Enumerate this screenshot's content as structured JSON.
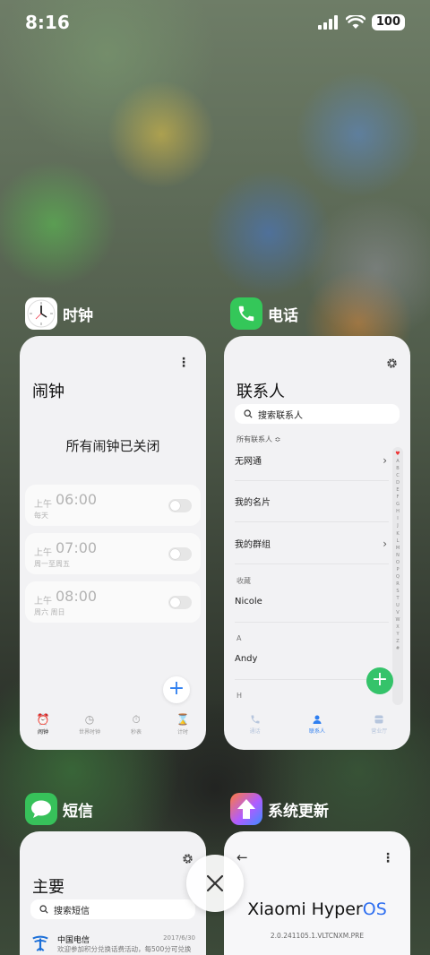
{
  "status_bar": {
    "time": "8:16",
    "battery": "100"
  },
  "apps": {
    "clock": {
      "label": "时钟",
      "screen_title": "闹钟",
      "status_text": "所有闹钟已关闭",
      "alarms": [
        {
          "ampm": "上午",
          "time": "06:00",
          "days": "每天",
          "enabled": false
        },
        {
          "ampm": "上午",
          "time": "07:00",
          "days": "周一至周五",
          "enabled": false
        },
        {
          "ampm": "上午",
          "time": "08:00",
          "days": "周六 周日",
          "enabled": false
        }
      ],
      "nav": [
        {
          "label": "闹钟",
          "icon": "alarm-clock-icon",
          "active": true
        },
        {
          "label": "世界时钟",
          "icon": "world-clock-icon",
          "active": false
        },
        {
          "label": "秒表",
          "icon": "stopwatch-icon",
          "active": false
        },
        {
          "label": "计时",
          "icon": "hourglass-icon",
          "active": false
        }
      ]
    },
    "phone": {
      "label": "电话",
      "screen_title": "联系人",
      "search_placeholder": "搜索联系人",
      "filter": "所有联系人 ≎",
      "rows": [
        {
          "label": "无网通",
          "chevron": true
        },
        {
          "label": "我的名片",
          "chevron": false
        },
        {
          "label": "我的群组",
          "chevron": true
        }
      ],
      "sections": [
        {
          "header": "收藏",
          "contact": "Nicole"
        },
        {
          "header": "A",
          "contact": "Andy"
        },
        {
          "header": "H",
          "contact": ""
        }
      ],
      "alphabet": [
        "A",
        "B",
        "C",
        "D",
        "E",
        "F",
        "G",
        "H",
        "I",
        "J",
        "K",
        "L",
        "M",
        "N",
        "O",
        "P",
        "Q",
        "R",
        "S",
        "T",
        "U",
        "V",
        "W",
        "X",
        "Y",
        "Z",
        "#"
      ],
      "nav": [
        {
          "label": "通话",
          "icon": "phone-icon",
          "active": false
        },
        {
          "label": "联系人",
          "icon": "person-icon",
          "active": true
        },
        {
          "label": "营业厅",
          "icon": "store-icon",
          "active": false
        }
      ]
    },
    "messages": {
      "label": "短信",
      "screen_title": "主要",
      "search_placeholder": "搜索短信",
      "threads": [
        {
          "sender": "中国电信",
          "date": "2017/6/30",
          "snippet": "欢迎参加积分兑换话费活动，每500分可兑换"
        }
      ]
    },
    "update": {
      "label": "系统更新",
      "brand_prefix": "Xiaomi Hyper",
      "brand_suffix": "OS",
      "version": "2.0.241105.1.VLTCNXM.PRE"
    }
  },
  "colors": {
    "accent_blue": "#2f7ff0",
    "fab_green": "#35c36a",
    "phone_icon_green": "#34c759"
  }
}
